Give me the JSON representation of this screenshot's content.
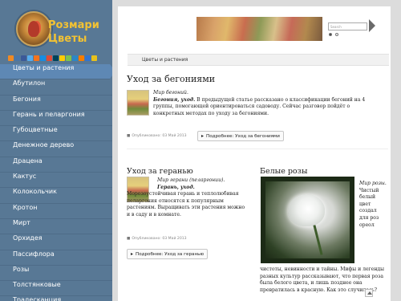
{
  "site": {
    "title": "Розмари",
    "subtitle": "Цветы"
  },
  "social": {
    "icons": [
      "rss-icon",
      "vk-icon",
      "facebook-icon",
      "twitter-icon",
      "odnoklassniki-icon",
      "mailru-icon",
      "google-icon",
      "livejournal-icon",
      "yandex-icon",
      "liveinternet-icon",
      "moimir-icon",
      "blogger-icon",
      "delicious-icon",
      "favorites-icon"
    ],
    "colors": [
      "#f08a24",
      "#4a76a8",
      "#3b5998",
      "#55acee",
      "#f4731c",
      "#168de2",
      "#dd4b39",
      "#004359",
      "#ffcc00",
      "#7ec24f",
      "#2b87c7",
      "#f57d00",
      "#3274d1",
      "#e8c11c"
    ]
  },
  "sidebar": {
    "items": [
      {
        "label": "Цветы и растения",
        "active": true
      },
      {
        "label": "Абутилон"
      },
      {
        "label": "Бегония"
      },
      {
        "label": "Герань и пеларгония"
      },
      {
        "label": "Губоцветные"
      },
      {
        "label": "Денежное дерево"
      },
      {
        "label": "Драцена"
      },
      {
        "label": "Кактус"
      },
      {
        "label": "Колокольчик"
      },
      {
        "label": "Кротон"
      },
      {
        "label": "Мирт"
      },
      {
        "label": "Орхидея"
      },
      {
        "label": "Пассифлора"
      },
      {
        "label": "Розы"
      },
      {
        "label": "Толстянковые"
      },
      {
        "label": "Традесканция"
      }
    ]
  },
  "header": {
    "search_placeholder": "Search"
  },
  "breadcrumb": "Цветы и растения",
  "articles": [
    {
      "title": "Уход за бегониями",
      "lead": "Мир бегоний.",
      "bold": "Бегония, уход.",
      "text": " В предыдущей статье рассказано о классификации бегоний на 4 группы, помогающей ориентироваться садоводу. Сейчас разговор пойдёт о конкретных методах по уходу за бегониями.",
      "meta": "Опубликовано: 03 Май 2013",
      "more": "Подробнее: Уход за бегониями"
    },
    {
      "title": "Уход за геранью",
      "lead": "Мир герани (пеларгонии).",
      "bold": "Герань, уход.",
      "text": " Морозоустойчивая герань и теплолюбивая пеларгония относятся к популярным растениям. Выращивать эти растения можно и в саду и в комнате.",
      "meta": "Опубликовано: 03 Май 2013",
      "more": "Подробнее: Уход за геранью"
    },
    {
      "title": "Белые розы",
      "lead": "Мир розы.",
      "side_text": "Чистый белый цвет создал для роз ореол",
      "bottom_text": "чистоты, невинности и тайны. Мифы и легенды разных культур рассказывают, что первая роза была белого цвета, и лишь позднее она превратилась в красную. Как это случилось?"
    }
  ]
}
